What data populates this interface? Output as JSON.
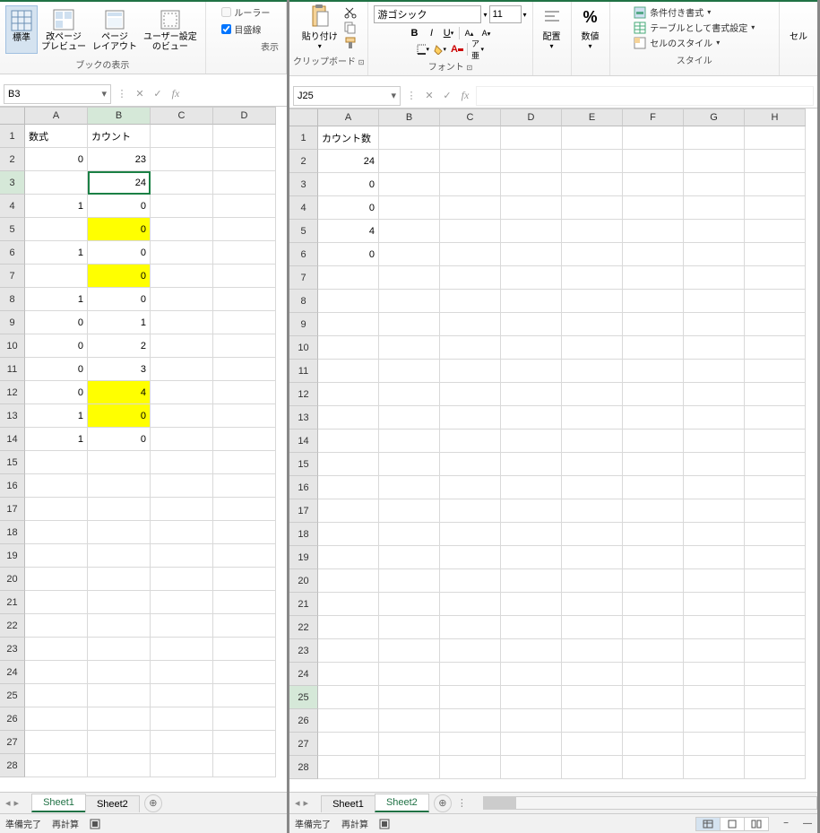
{
  "left": {
    "view_group_label": "ブックの表示",
    "display_group_label": "表示",
    "view_buttons": [
      {
        "label": "標準"
      },
      {
        "label": "改ページ\nプレビュー"
      },
      {
        "label": "ページ\nレイアウト"
      },
      {
        "label": "ユーザー設定\nのビュー"
      }
    ],
    "check_ruler": "ルーラー",
    "check_gridlines": "目盛線",
    "name_box": "B3",
    "col_headers": [
      "A",
      "B",
      "C",
      "D"
    ],
    "row_count": 28,
    "header_row": {
      "A": "数式",
      "B": "カウント"
    },
    "rows": [
      {
        "A": "0",
        "B": "23",
        "hl": false
      },
      {
        "A": "",
        "B": "24",
        "hl": true
      },
      {
        "A": "1",
        "B": "0",
        "hl": false
      },
      {
        "A": "",
        "B": "0",
        "hl": true
      },
      {
        "A": "1",
        "B": "0",
        "hl": false
      },
      {
        "A": "",
        "B": "0",
        "hl": true
      },
      {
        "A": "1",
        "B": "0",
        "hl": false
      },
      {
        "A": "0",
        "B": "1",
        "hl": false
      },
      {
        "A": "0",
        "B": "2",
        "hl": false
      },
      {
        "A": "0",
        "B": "3",
        "hl": false
      },
      {
        "A": "0",
        "B": "4",
        "hl": true
      },
      {
        "A": "1",
        "B": "0",
        "hl": true
      },
      {
        "A": "1",
        "B": "0",
        "hl": false
      }
    ],
    "tabs": [
      "Sheet1",
      "Sheet2"
    ],
    "active_tab": 0,
    "status": [
      "準備完了",
      "再計算"
    ]
  },
  "right": {
    "paste_label": "貼り付け",
    "clipboard_label": "クリップボード",
    "font_name": "游ゴシック",
    "font_size": "11",
    "font_label": "フォント",
    "align_label": "配置",
    "number_label": "数値",
    "styles_label": "スタイル",
    "cells_label": "セル",
    "style_items": [
      "条件付き書式",
      "テーブルとして書式設定",
      "セルのスタイル"
    ],
    "name_box": "J25",
    "col_headers": [
      "A",
      "B",
      "C",
      "D",
      "E",
      "F",
      "G",
      "H"
    ],
    "row_count": 28,
    "header_row": {
      "A": "カウント数"
    },
    "rows": [
      {
        "A": "24"
      },
      {
        "A": "0"
      },
      {
        "A": "0"
      },
      {
        "A": "4"
      },
      {
        "A": "0"
      }
    ],
    "selected_row": 25,
    "tabs": [
      "Sheet1",
      "Sheet2"
    ],
    "active_tab": 1,
    "status": [
      "準備完了",
      "再計算"
    ]
  }
}
